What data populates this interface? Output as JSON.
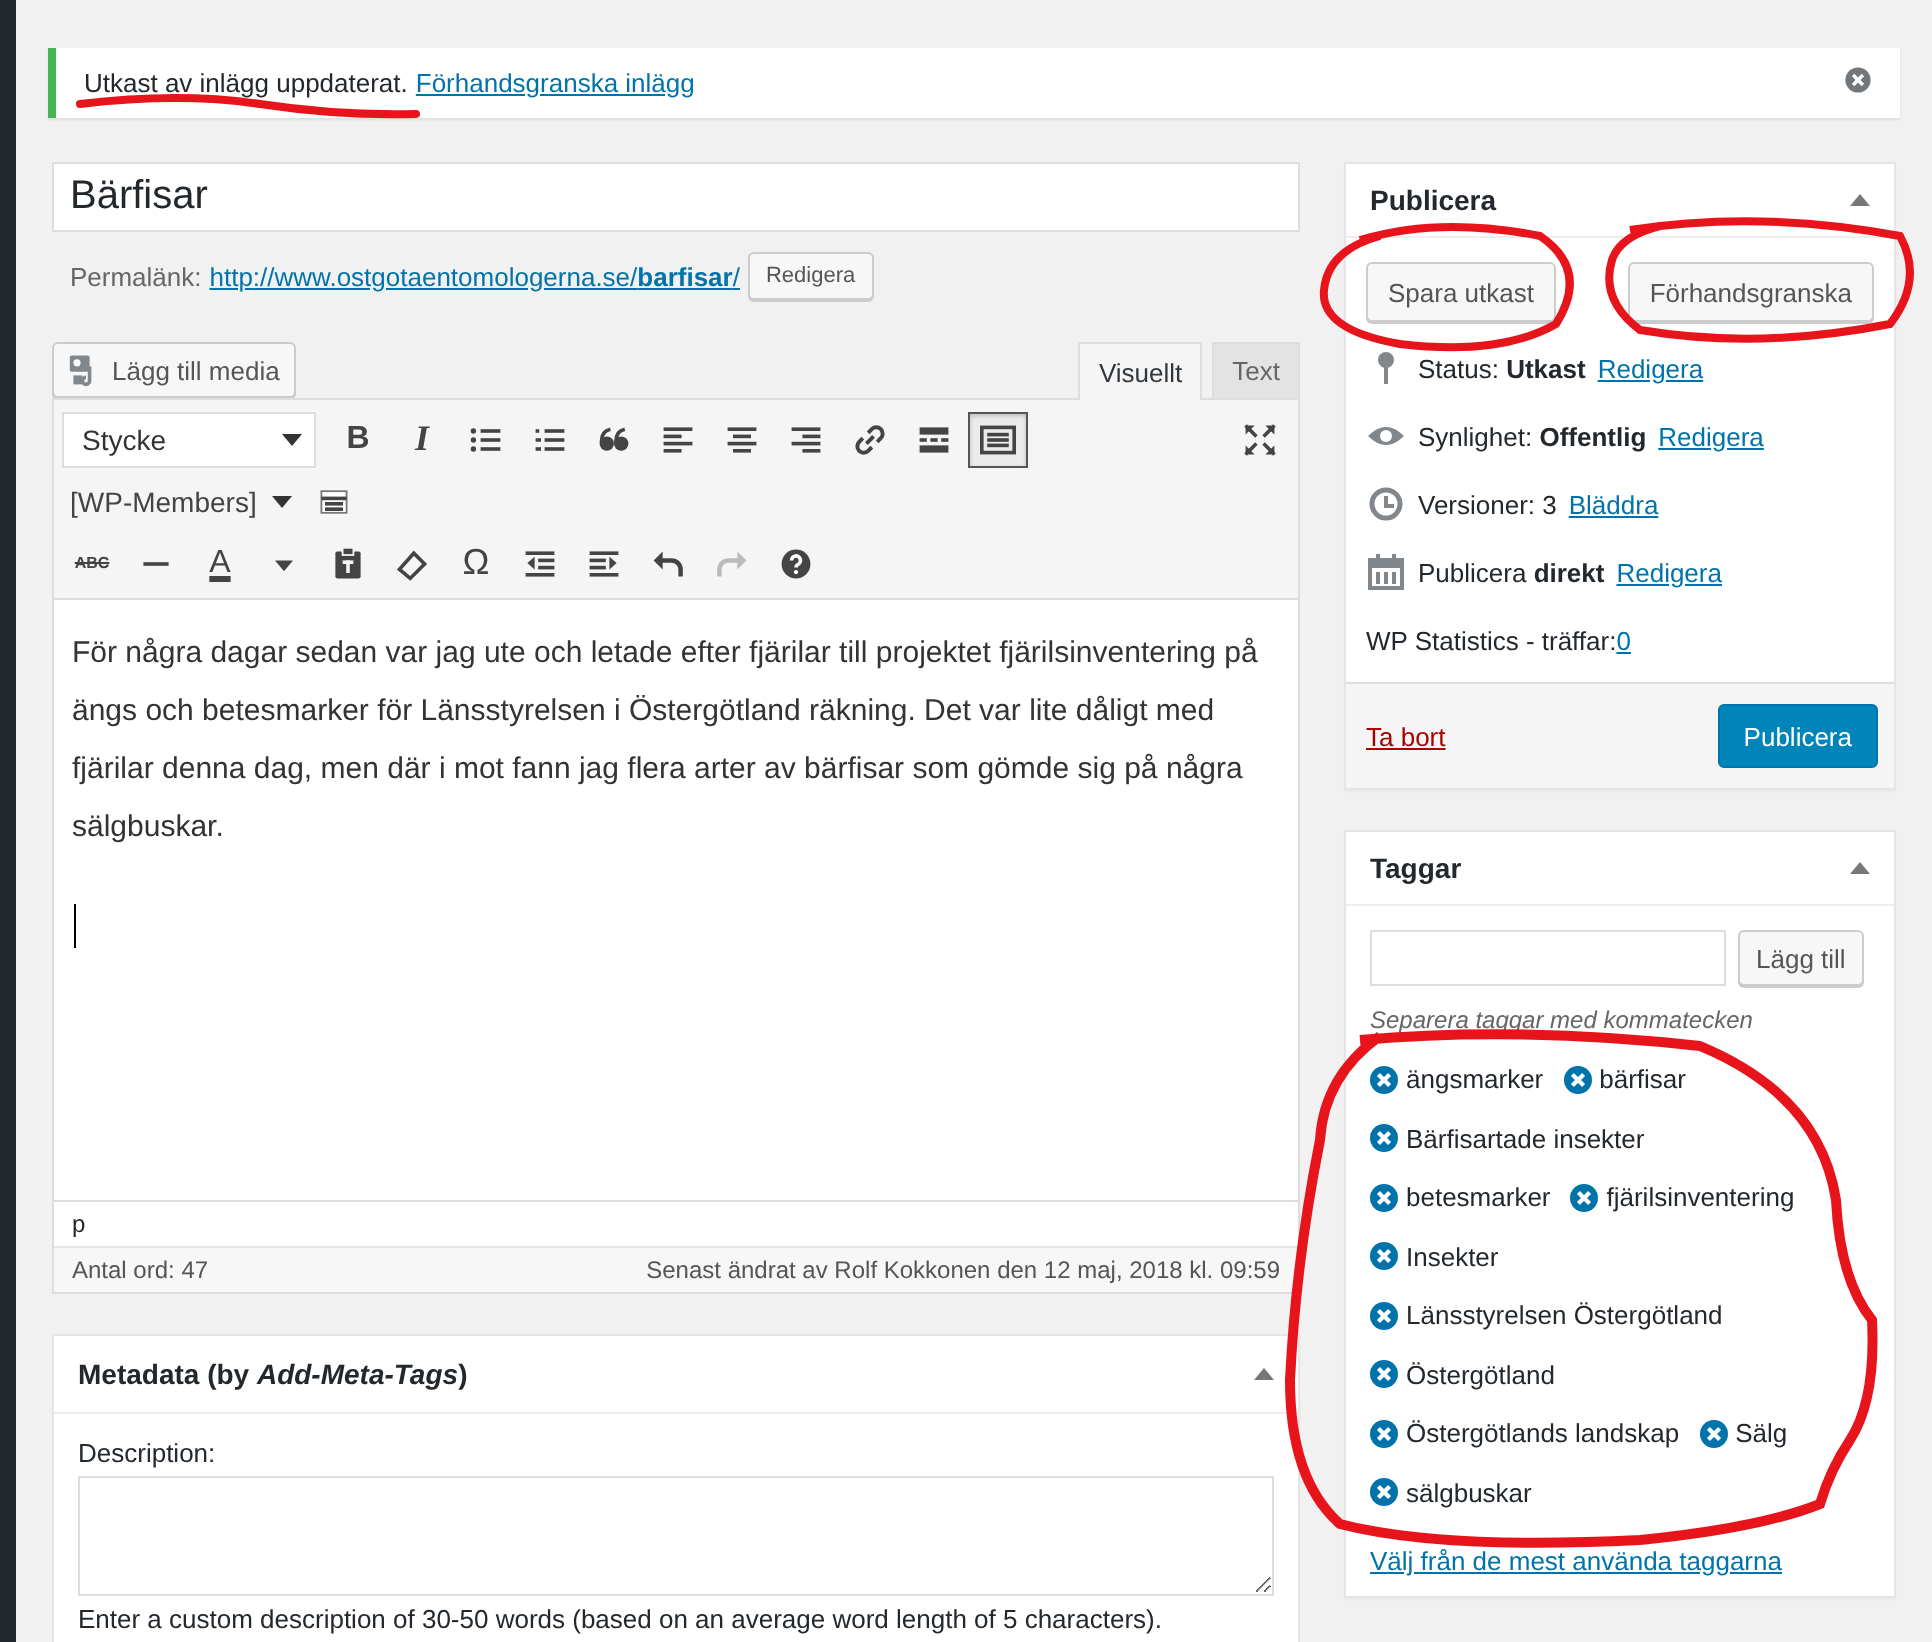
{
  "notice": {
    "message": "Utkast av inlägg uppdaterat.",
    "link": "Förhandsgranska inlägg"
  },
  "title_field": {
    "value": "Bärfisar"
  },
  "permalink": {
    "label": "Permalänk:",
    "url": "http://www.ostgotaentomologerna.se/",
    "slug": "barfisar",
    "url_end": "/",
    "button": "Redigera"
  },
  "media_button": "Lägg till media",
  "editor_tabs": [
    {
      "label": "Visuellt",
      "selected": true
    },
    {
      "label": "Text",
      "selected": false
    }
  ],
  "toolbar": {
    "format_select": "Stycke",
    "members_select": "[WP-Members]",
    "glyphs": [
      "B",
      "I",
      "ABC",
      "A",
      "Ω"
    ],
    "toggle_on": true
  },
  "content": [
    "För några dagar sedan var jag ute och letade efter fjärilar till projektet fjärilsinventering på ängs och betesmarker för Länsstyrelsen i Östergötland räkning. Det var lite dåligt med fjärilar denna dag, men där i mot fann jag flera arter av bärfisar som gömde sig på några sälgbuskar."
  ],
  "path_bar": "p",
  "word_count": "Antal ord: 47",
  "last_edited": "Senast ändrat av Rolf Kokkonen den 12 maj, 2018 kl. 09:59",
  "metadata_box": {
    "title_start": "Metadata (by ",
    "title_em": "Add-Meta-Tags",
    "title_end": ")",
    "field_label": "Description:",
    "help": "Enter a custom description of 30-50 words (based on an average word length of 5 characters)."
  },
  "publish_box": {
    "title": "Publicera",
    "save_draft": "Spara utkast",
    "preview": "Förhandsgranska",
    "rows": [
      {
        "kind": "status",
        "label": "Status: ",
        "value": "Utkast",
        "link": "Redigera"
      },
      {
        "kind": "visibility",
        "label": "Synlighet: ",
        "value": "Offentlig",
        "link": "Redigera"
      },
      {
        "kind": "revisions",
        "label": "Versioner: 3",
        "link": "Bläddra"
      },
      {
        "kind": "schedule",
        "label": "Publicera ",
        "value": "direkt",
        "link": "Redigera"
      }
    ],
    "stats_label": "WP Statistics - träffar: ",
    "stats_link": "0",
    "trash": "Ta bort",
    "publish": "Publicera"
  },
  "tags_box": {
    "title": "Taggar",
    "add_button": "Lägg till",
    "hint": "Separera taggar med kommatecken",
    "tag_rows": [
      [
        "ängsmarker",
        "bärfisar"
      ],
      [
        "Bärfisartade insekter"
      ],
      [
        "betesmarker",
        "fjärilsinventering"
      ],
      [
        "Insekter"
      ],
      [
        "Länsstyrelsen Östergötland"
      ],
      [
        "Östergötland"
      ],
      [
        "Östergötlands landskap",
        "Sälg"
      ],
      [
        "sälgbuskar"
      ]
    ],
    "choose_link": "Välj från de mest använda taggarna"
  }
}
